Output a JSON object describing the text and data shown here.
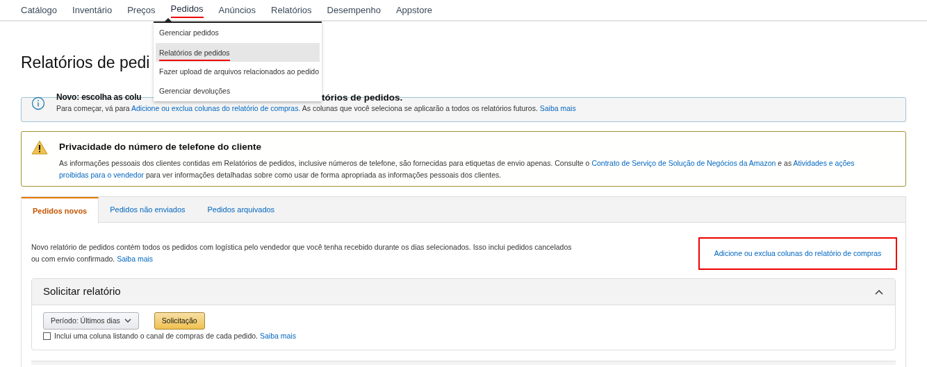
{
  "nav": {
    "items": [
      {
        "label": "Catálogo",
        "selected": false
      },
      {
        "label": "Inventário",
        "selected": false
      },
      {
        "label": "Preços",
        "selected": false
      },
      {
        "label": "Pedidos",
        "selected": true
      },
      {
        "label": "Anúncios",
        "selected": false
      },
      {
        "label": "Relatórios",
        "selected": false
      },
      {
        "label": "Desempenho",
        "selected": false
      },
      {
        "label": "Appstore",
        "selected": false
      }
    ]
  },
  "menu": {
    "items": [
      {
        "label": "Gerenciar pedidos",
        "selected": false
      },
      {
        "label": "Relatórios de pedidos",
        "selected": true
      },
      {
        "label": "Fazer upload de arquivos relacionados ao pedido",
        "selected": false
      },
      {
        "label": "Gerenciar devoluções",
        "selected": false
      }
    ]
  },
  "page_title": "Relatórios de pedi",
  "info_banner": {
    "title_start": "Novo: escolha as colu",
    "title_end": "tórios de pedidos.",
    "text": "Para começar, vá para ",
    "link": "Adicione ou exclua colunas do relatório de compras.",
    "text_after": " As colunas que você seleciona se aplicarão a todos os relatórios futuros. ",
    "more": "Saiba mais"
  },
  "warning_banner": {
    "title": "Privacidade do número de telefone do cliente",
    "text": "As informações pessoais dos clientes contidas em Relatórios de pedidos, inclusive números de telefone, são fornecidas para etiquetas de envio apenas. Consulte o ",
    "link1": "Contrato de Serviço de Solução de Negócios da Amazon",
    "middle": " e as ",
    "link2a": "Atividades e ações",
    "link2b": "proibidas para o vendedor",
    "text_after": " para ver informações detalhadas sobre como usar de forma apropriada as informações pessoais dos clientes."
  },
  "tabs": [
    {
      "label": "Pedidos novos",
      "selected": true
    },
    {
      "label": "Pedidos não enviados",
      "selected": false
    },
    {
      "label": "Pedidos arquivados",
      "selected": false
    }
  ],
  "description": {
    "text": "Novo relatório de pedidos contém todos os pedidos com logística pelo vendedor que você tenha recebido durante os dias selecionados. Isso inclui pedidos cancelados ou com envio confirmado. ",
    "more": "Saiba mais"
  },
  "columns_link": "Adicione ou exclua colunas do relatório de compras",
  "request_panel": {
    "title": "Solicitar relatório",
    "expanded": true,
    "period": "Período: Últimos dias",
    "button": "Solicitação",
    "checkbox": {
      "label": "Inclui uma coluna listando o canal de compras de cada pedido. ",
      "more": "Saiba mais",
      "checked": false
    }
  }
}
